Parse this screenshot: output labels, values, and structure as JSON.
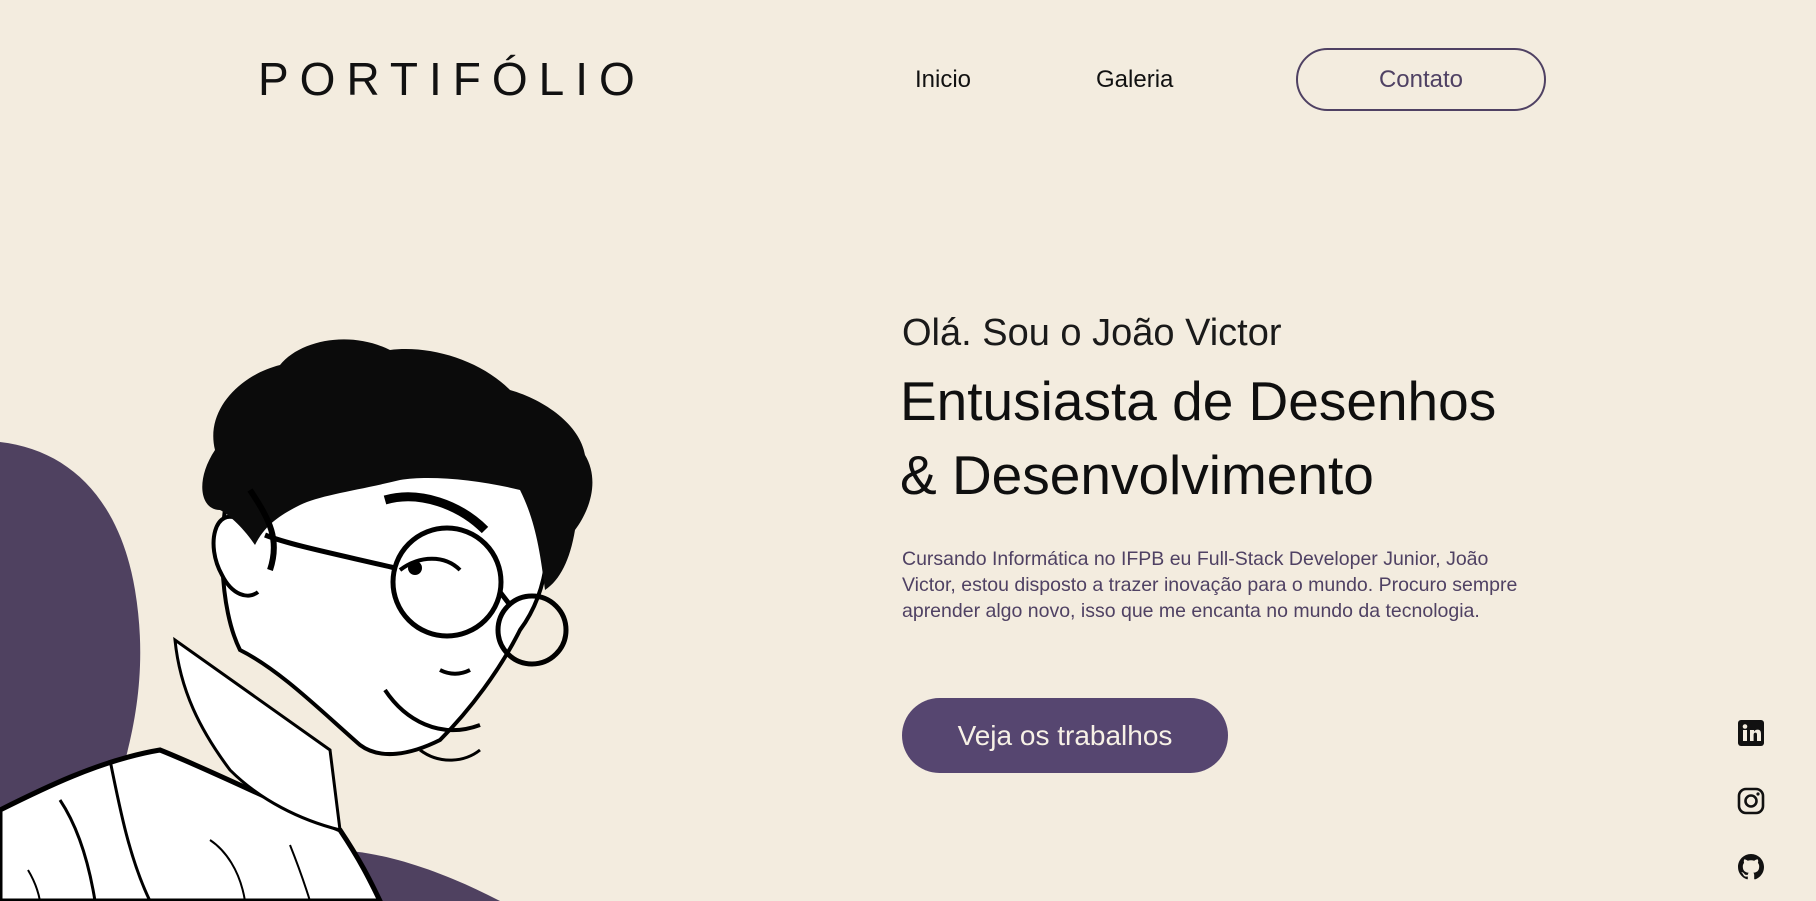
{
  "header": {
    "logo": "PORTIFÓLIO",
    "nav": [
      {
        "label": "Inicio"
      },
      {
        "label": "Galeria"
      }
    ],
    "contact_label": "Contato"
  },
  "hero": {
    "greeting": "Olá. Sou o João Victor",
    "headline_line1": "Entusiasta de Desenhos",
    "headline_line2": "& Desenvolvimento",
    "description": "Cursando Informática no IFPB eu Full-Stack Developer Junior, João Victor, estou disposto a trazer inovação para o mundo. Procuro sempre aprender algo novo, isso que me encanta no mundo da tecnologia.",
    "cta_label": "Veja os trabalhos"
  },
  "social": [
    {
      "icon": "linkedin-icon"
    },
    {
      "icon": "instagram-icon"
    },
    {
      "icon": "github-icon"
    }
  ],
  "colors": {
    "background": "#f3ecdf",
    "accent": "#564670",
    "text": "#111111"
  }
}
